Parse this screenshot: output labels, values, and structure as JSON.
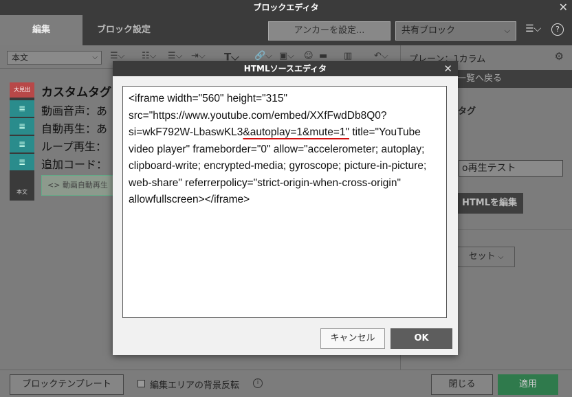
{
  "window": {
    "title": "ブロックエディタ"
  },
  "tabs": {
    "edit": "編集",
    "block_settings": "ブロック設定"
  },
  "header": {
    "anchor_button": "アンカーを設定...",
    "shared_block_select": "共有ブロック"
  },
  "toolbar": {
    "style_select": "本文"
  },
  "right_panel": {
    "layout": "プレーン：1カラム",
    "back_link": "一覧へ戻る",
    "custom_tag_label": "ムタグ",
    "name_field": "o再生テスト",
    "edit_html_button": "HTMLを編集",
    "set_button": "セット"
  },
  "content": {
    "sidebar_head": "大見出",
    "sidebar_body": "本文",
    "heading": "カスタムタグ",
    "lines": [
      "動画音声：あ",
      "自動再生：あ",
      "ループ再生：",
      "追加コード："
    ],
    "embed_label": "動画自動再生"
  },
  "bottom": {
    "template_button": "ブロックテンプレート",
    "bg_invert_label": "編集エリアの背景反転",
    "close_button": "閉じる",
    "apply_button": "適用"
  },
  "modal": {
    "title": "HTMLソースエディタ",
    "code_before": "<iframe width=\"560\" height=\"315\" src=\"https://www.youtube.com/embed/XXfFwdDb8Q0?si=wkF792W-LbaswKL3",
    "code_highlight": "&autoplay=1&mute=1\"",
    "code_after": " title=\"YouTube video player\" frameborder=\"0\" allow=\"accelerometer; autoplay; clipboard-write; encrypted-media; gyroscope; picture-in-picture; web-share\" referrerpolicy=\"strict-origin-when-cross-origin\" allowfullscreen></iframe>",
    "cancel_button": "キャンセル",
    "ok_button": "OK"
  }
}
